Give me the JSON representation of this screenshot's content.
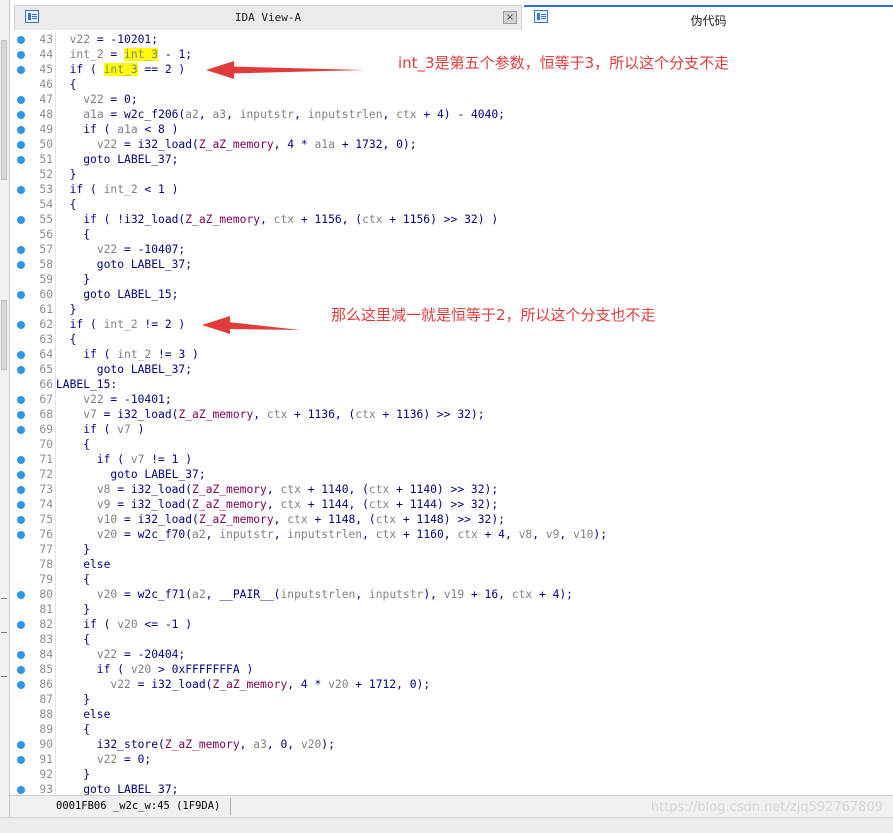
{
  "tabs": {
    "ida_view": "IDA View-A",
    "pseudocode": "伪代码",
    "close_glyph": "×"
  },
  "annotations": {
    "first": "int_3是第五个参数，恒等于3，所以这个分支不走",
    "second": "那么这里减一就是恒等于2，所以这个分支也不走",
    "color": "#e03c3c"
  },
  "status": {
    "location": "0001FB06 _w2c_w:45 (1F9DA)",
    "watermark": "https://blog.csdn.net/zjq592767809"
  },
  "code_lines": [
    {
      "n": "43",
      "dot": true,
      "segs": [
        [
          "  "
        ],
        [
          "v22",
          "v"
        ],
        [
          " = -10201;"
        ]
      ]
    },
    {
      "n": "44",
      "dot": true,
      "segs": [
        [
          "  "
        ],
        [
          "int_2",
          "v"
        ],
        [
          " = "
        ],
        [
          "int_3",
          "v hl"
        ],
        [
          " - 1;"
        ]
      ]
    },
    {
      "n": "45",
      "dot": true,
      "segs": [
        [
          "  if ( "
        ],
        [
          "int_3",
          "v hl"
        ],
        [
          " == 2 )"
        ]
      ]
    },
    {
      "n": "46",
      "dot": false,
      "segs": [
        [
          "  {"
        ]
      ]
    },
    {
      "n": "47",
      "dot": true,
      "segs": [
        [
          "    "
        ],
        [
          "v22",
          "v"
        ],
        [
          " = 0;"
        ]
      ]
    },
    {
      "n": "48",
      "dot": true,
      "segs": [
        [
          "    "
        ],
        [
          "a1a",
          "v"
        ],
        [
          " = w2c_f206("
        ],
        [
          "a2",
          "v"
        ],
        [
          ", "
        ],
        [
          "a3",
          "v"
        ],
        [
          ", "
        ],
        [
          "inputstr",
          "v"
        ],
        [
          ", "
        ],
        [
          "inputstrlen",
          "v"
        ],
        [
          ", "
        ],
        [
          "ctx",
          "v"
        ],
        [
          " + 4) - 4040;"
        ]
      ]
    },
    {
      "n": "49",
      "dot": true,
      "segs": [
        [
          "    if ( "
        ],
        [
          "a1a",
          "v"
        ],
        [
          " < 8 )"
        ]
      ]
    },
    {
      "n": "50",
      "dot": true,
      "segs": [
        [
          "      "
        ],
        [
          "v22",
          "v"
        ],
        [
          " = i32_load("
        ],
        [
          "Z_aZ_memory",
          "g"
        ],
        [
          ", 4 * "
        ],
        [
          "a1a",
          "v"
        ],
        [
          " + 1732, 0);"
        ]
      ]
    },
    {
      "n": "51",
      "dot": true,
      "segs": [
        [
          "    goto LABEL_37;"
        ]
      ]
    },
    {
      "n": "52",
      "dot": false,
      "segs": [
        [
          "  }"
        ]
      ]
    },
    {
      "n": "53",
      "dot": true,
      "segs": [
        [
          "  if ( "
        ],
        [
          "int_2",
          "v"
        ],
        [
          " < 1 )"
        ]
      ]
    },
    {
      "n": "54",
      "dot": false,
      "segs": [
        [
          "  {"
        ]
      ]
    },
    {
      "n": "55",
      "dot": true,
      "segs": [
        [
          "    if ( !i32_load("
        ],
        [
          "Z_aZ_memory",
          "g"
        ],
        [
          ", "
        ],
        [
          "ctx",
          "v"
        ],
        [
          " + 1156, ("
        ],
        [
          "ctx",
          "v"
        ],
        [
          " + 1156) >> 32) )"
        ]
      ]
    },
    {
      "n": "56",
      "dot": false,
      "segs": [
        [
          "    {"
        ]
      ]
    },
    {
      "n": "57",
      "dot": true,
      "segs": [
        [
          "      "
        ],
        [
          "v22",
          "v"
        ],
        [
          " = -10407;"
        ]
      ]
    },
    {
      "n": "58",
      "dot": true,
      "segs": [
        [
          "      goto LABEL_37;"
        ]
      ]
    },
    {
      "n": "59",
      "dot": false,
      "segs": [
        [
          "    }"
        ]
      ]
    },
    {
      "n": "60",
      "dot": true,
      "segs": [
        [
          "    goto LABEL_15;"
        ]
      ]
    },
    {
      "n": "61",
      "dot": false,
      "segs": [
        [
          "  }"
        ]
      ]
    },
    {
      "n": "62",
      "dot": true,
      "segs": [
        [
          "  if ( "
        ],
        [
          "int_2",
          "v"
        ],
        [
          " != 2 )"
        ]
      ]
    },
    {
      "n": "63",
      "dot": false,
      "segs": [
        [
          "  {"
        ]
      ]
    },
    {
      "n": "64",
      "dot": true,
      "segs": [
        [
          "    if ( "
        ],
        [
          "int_2",
          "v"
        ],
        [
          " != 3 )"
        ]
      ]
    },
    {
      "n": "65",
      "dot": true,
      "segs": [
        [
          "      goto LABEL_37;"
        ]
      ]
    },
    {
      "n": "66",
      "dot": false,
      "segs": [
        [
          "LABEL_15:"
        ]
      ]
    },
    {
      "n": "67",
      "dot": true,
      "segs": [
        [
          "    "
        ],
        [
          "v22",
          "v"
        ],
        [
          " = -10401;"
        ]
      ]
    },
    {
      "n": "68",
      "dot": true,
      "segs": [
        [
          "    "
        ],
        [
          "v7",
          "v"
        ],
        [
          " = i32_load("
        ],
        [
          "Z_aZ_memory",
          "g"
        ],
        [
          ", "
        ],
        [
          "ctx",
          "v"
        ],
        [
          " + 1136, ("
        ],
        [
          "ctx",
          "v"
        ],
        [
          " + 1136) >> 32);"
        ]
      ]
    },
    {
      "n": "69",
      "dot": true,
      "segs": [
        [
          "    if ( "
        ],
        [
          "v7",
          "v"
        ],
        [
          " )"
        ]
      ]
    },
    {
      "n": "70",
      "dot": false,
      "segs": [
        [
          "    {"
        ]
      ]
    },
    {
      "n": "71",
      "dot": true,
      "segs": [
        [
          "      if ( "
        ],
        [
          "v7",
          "v"
        ],
        [
          " != 1 )"
        ]
      ]
    },
    {
      "n": "72",
      "dot": true,
      "segs": [
        [
          "        goto LABEL_37;"
        ]
      ]
    },
    {
      "n": "73",
      "dot": true,
      "segs": [
        [
          "      "
        ],
        [
          "v8",
          "v"
        ],
        [
          " = i32_load("
        ],
        [
          "Z_aZ_memory",
          "g"
        ],
        [
          ", "
        ],
        [
          "ctx",
          "v"
        ],
        [
          " + 1140, ("
        ],
        [
          "ctx",
          "v"
        ],
        [
          " + 1140) >> 32);"
        ]
      ]
    },
    {
      "n": "74",
      "dot": true,
      "segs": [
        [
          "      "
        ],
        [
          "v9",
          "v"
        ],
        [
          " = i32_load("
        ],
        [
          "Z_aZ_memory",
          "g"
        ],
        [
          ", "
        ],
        [
          "ctx",
          "v"
        ],
        [
          " + 1144, ("
        ],
        [
          "ctx",
          "v"
        ],
        [
          " + 1144) >> 32);"
        ]
      ]
    },
    {
      "n": "75",
      "dot": true,
      "segs": [
        [
          "      "
        ],
        [
          "v10",
          "v"
        ],
        [
          " = i32_load("
        ],
        [
          "Z_aZ_memory",
          "g"
        ],
        [
          ", "
        ],
        [
          "ctx",
          "v"
        ],
        [
          " + 1148, ("
        ],
        [
          "ctx",
          "v"
        ],
        [
          " + 1148) >> 32);"
        ]
      ]
    },
    {
      "n": "76",
      "dot": true,
      "segs": [
        [
          "      "
        ],
        [
          "v20",
          "v"
        ],
        [
          " = w2c_f70("
        ],
        [
          "a2",
          "v"
        ],
        [
          ", "
        ],
        [
          "inputstr",
          "v"
        ],
        [
          ", "
        ],
        [
          "inputstrlen",
          "v"
        ],
        [
          ", "
        ],
        [
          "ctx",
          "v"
        ],
        [
          " + 1160, "
        ],
        [
          "ctx",
          "v"
        ],
        [
          " + 4, "
        ],
        [
          "v8",
          "v"
        ],
        [
          ", "
        ],
        [
          "v9",
          "v"
        ],
        [
          ", "
        ],
        [
          "v10",
          "v"
        ],
        [
          ");"
        ]
      ]
    },
    {
      "n": "77",
      "dot": false,
      "segs": [
        [
          "    }"
        ]
      ]
    },
    {
      "n": "78",
      "dot": false,
      "segs": [
        [
          "    else"
        ]
      ]
    },
    {
      "n": "79",
      "dot": false,
      "segs": [
        [
          "    {"
        ]
      ]
    },
    {
      "n": "80",
      "dot": true,
      "segs": [
        [
          "      "
        ],
        [
          "v20",
          "v"
        ],
        [
          " = w2c_f71("
        ],
        [
          "a2",
          "v"
        ],
        [
          ", __PAIR__("
        ],
        [
          "inputstrlen",
          "v"
        ],
        [
          ", "
        ],
        [
          "inputstr",
          "v"
        ],
        [
          "), "
        ],
        [
          "v19",
          "v"
        ],
        [
          " + 16, "
        ],
        [
          "ctx",
          "v"
        ],
        [
          " + 4);"
        ]
      ]
    },
    {
      "n": "81",
      "dot": false,
      "segs": [
        [
          "    }"
        ]
      ]
    },
    {
      "n": "82",
      "dot": true,
      "segs": [
        [
          "    if ( "
        ],
        [
          "v20",
          "v"
        ],
        [
          " <= -1 )"
        ]
      ]
    },
    {
      "n": "83",
      "dot": false,
      "segs": [
        [
          "    {"
        ]
      ]
    },
    {
      "n": "84",
      "dot": true,
      "segs": [
        [
          "      "
        ],
        [
          "v22",
          "v"
        ],
        [
          " = -20404;"
        ]
      ]
    },
    {
      "n": "85",
      "dot": true,
      "segs": [
        [
          "      if ( "
        ],
        [
          "v20",
          "v"
        ],
        [
          " > 0xFFFFFFFA )"
        ]
      ]
    },
    {
      "n": "86",
      "dot": true,
      "segs": [
        [
          "        "
        ],
        [
          "v22",
          "v"
        ],
        [
          " = i32_load("
        ],
        [
          "Z_aZ_memory",
          "g"
        ],
        [
          ", 4 * "
        ],
        [
          "v20",
          "v"
        ],
        [
          " + 1712, 0);"
        ]
      ]
    },
    {
      "n": "87",
      "dot": false,
      "segs": [
        [
          "    }"
        ]
      ]
    },
    {
      "n": "88",
      "dot": false,
      "segs": [
        [
          "    else"
        ]
      ]
    },
    {
      "n": "89",
      "dot": false,
      "segs": [
        [
          "    {"
        ]
      ]
    },
    {
      "n": "90",
      "dot": true,
      "segs": [
        [
          "      i32_store("
        ],
        [
          "Z_aZ_memory",
          "g"
        ],
        [
          ", "
        ],
        [
          "a3",
          "v"
        ],
        [
          ", 0, "
        ],
        [
          "v20",
          "v"
        ],
        [
          ");"
        ]
      ]
    },
    {
      "n": "91",
      "dot": true,
      "segs": [
        [
          "      "
        ],
        [
          "v22",
          "v"
        ],
        [
          " = 0;"
        ]
      ]
    },
    {
      "n": "92",
      "dot": false,
      "segs": [
        [
          "    }"
        ]
      ]
    },
    {
      "n": "93",
      "dot": true,
      "segs": [
        [
          "    goto LABEL_37;"
        ]
      ]
    }
  ]
}
